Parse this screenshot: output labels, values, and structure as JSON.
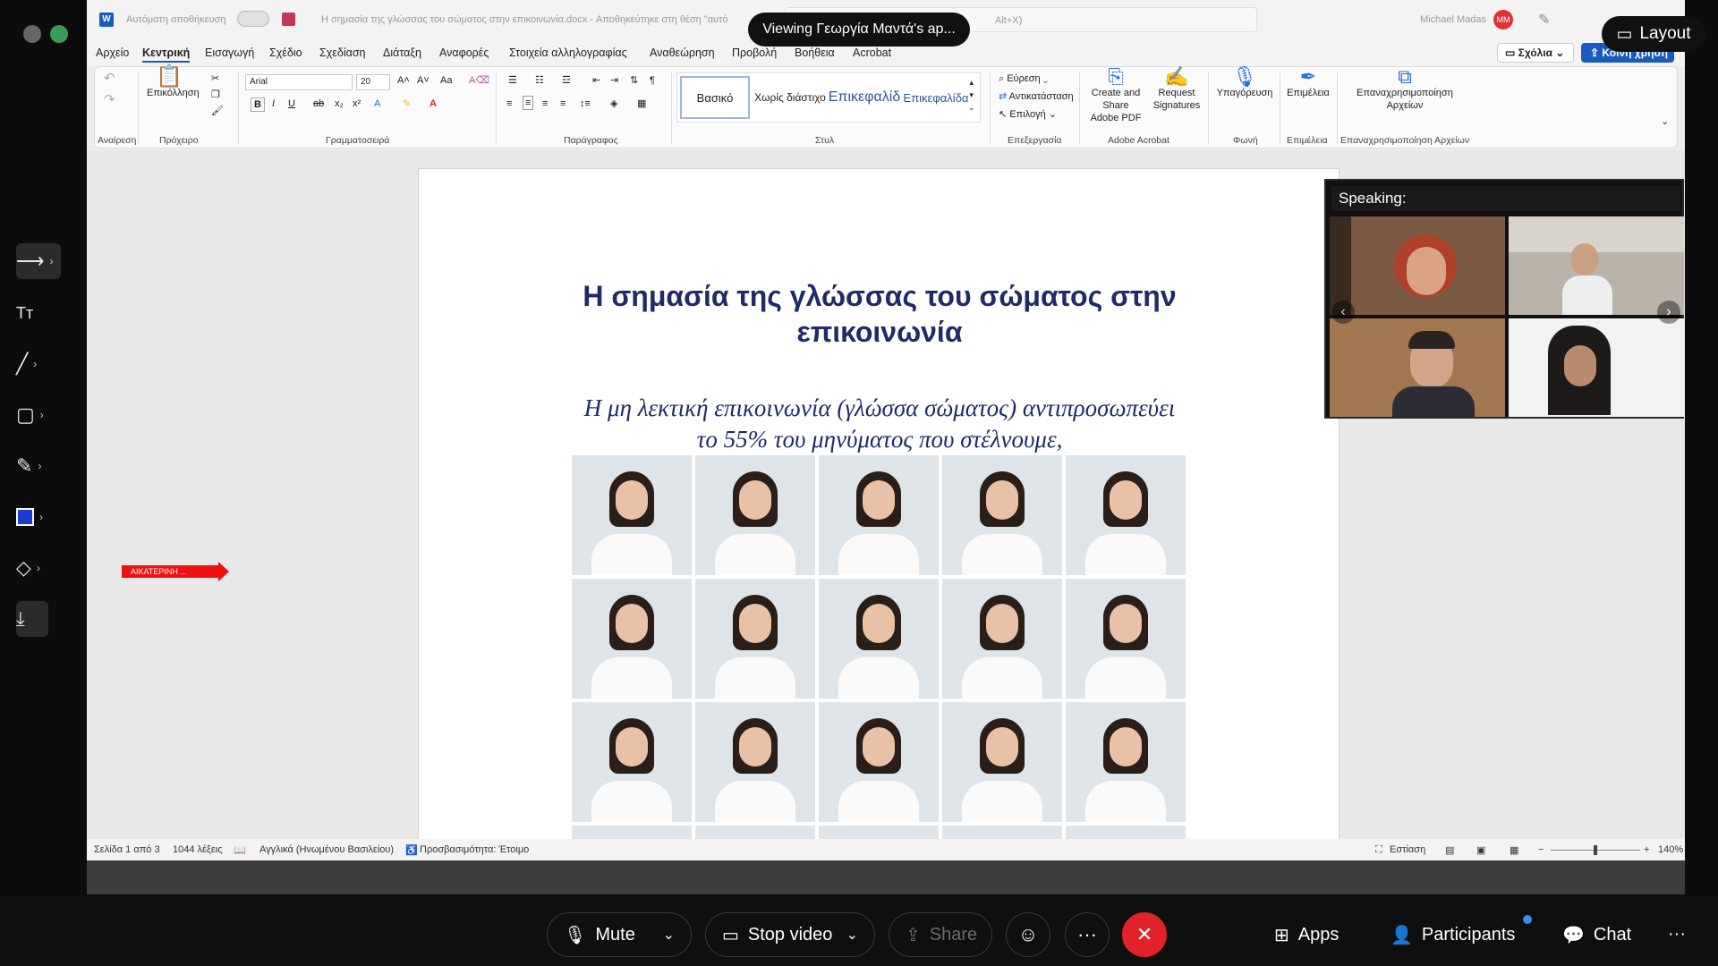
{
  "banner": {
    "text": "Viewing Γεωργία Μαντά's ap..."
  },
  "layout_button": {
    "label": "Layout"
  },
  "word": {
    "autosave_label": "Αυτόματη αποθήκευση",
    "doc_title": "Η σημασία της γλώσσας του σώματος στην επικοινωνία.docx  -  Αποθηκεύτηκε στη θέση \"αυτό",
    "search_hint": "Alt+X)",
    "user_name": "Michael Madas",
    "user_initials": "MM",
    "menu_tabs": [
      "Αρχείο",
      "Κεντρική",
      "Εισαγωγή",
      "Σχέδιο",
      "Σχεδίαση",
      "Διάταξη",
      "Αναφορές",
      "Στοιχεία αλληλογραφίας",
      "Αναθεώρηση",
      "Προβολή",
      "Βοήθεια",
      "Acrobat"
    ],
    "comments_label": "Σχόλια",
    "share_label": "Κοινή χρήση",
    "ribbon": {
      "undo_group": "Αναίρεση",
      "paste_label": "Επικόλληση",
      "clipboard_group": "Πρόχειρο",
      "font_name": "Arial",
      "font_size": "20",
      "font_group": "Γραμματοσειρά",
      "paragraph_group": "Παράγραφος",
      "styles": [
        "Βασικό",
        "Χωρίς διάστιχο",
        "Επικεφαλίδ",
        "Επικεφαλίδα"
      ],
      "styles_group": "Στυλ",
      "find_label": "Εύρεση",
      "replace_label": "Αντικατάσταση",
      "select_label": "Επιλογή",
      "editing_group": "Επεξεργασία",
      "acrobat_create": "Create and Share",
      "acrobat_create2": "Adobe PDF",
      "acrobat_request": "Request",
      "acrobat_request2": "Signatures",
      "acrobat_group": "Adobe Acrobat",
      "dictate_label": "Υπαγόρευση",
      "voice_group": "Φωνή",
      "editor_label": "Επιμέλεια",
      "editor_group": "Επιμέλεια",
      "reuse_label": "Επαναχρησιμοποίηση",
      "reuse_label2": "Αρχείων",
      "reuse_group": "Επαναχρησιμοποίηση Αρχείων"
    },
    "document": {
      "title_line1": "Η σημασία της γλώσσας του σώματος στην",
      "title_line2": "επικοινωνία",
      "subtitle_line1": "Η μη λεκτική επικοινωνία (γλώσσα σώματος) αντιπροσωπεύει",
      "subtitle_line2": "το 55% του μηνύματος που στέλνουμε,"
    },
    "status": {
      "page": "Σελίδα 1 από 3",
      "words": "1044 λέξεις",
      "language": "Αγγλικά (Ηνωμένου Βασιλείου)",
      "accessibility": "Προσβασιμότητα: Έτοιμο",
      "focus": "Εστίαση",
      "zoom": "140%"
    }
  },
  "annotation": {
    "text": "ΑΙΚΑΤΕΡΙΝΗ ..."
  },
  "speaking_panel": {
    "header": "Speaking:"
  },
  "controls": {
    "mute": "Mute",
    "stop_video": "Stop video",
    "share": "Share",
    "apps": "Apps",
    "participants": "Participants",
    "chat": "Chat"
  },
  "colors": {
    "accent": "#185abd",
    "end_call": "#e0232b",
    "doc_heading": "#1f2a66"
  }
}
